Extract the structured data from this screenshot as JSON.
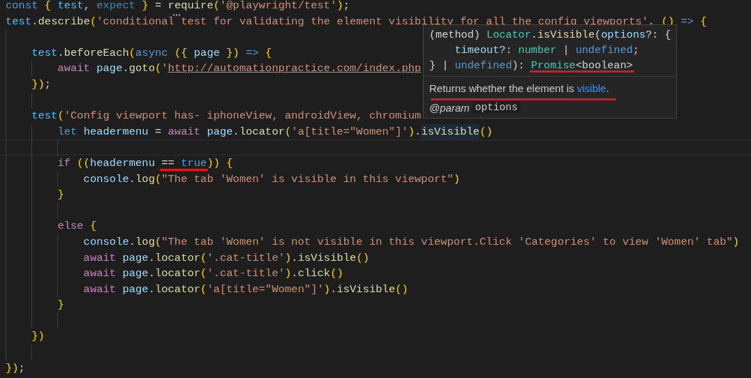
{
  "editor": {
    "lines": [
      {
        "kind": "code",
        "tokens": [
          {
            "kind": "kw",
            "text": "const"
          },
          {
            "kind": "br",
            "text": " {"
          },
          {
            "kind": "const",
            "text": " test"
          },
          {
            "kind": "pl",
            "text": ", "
          },
          {
            "kind": "unused",
            "text": "expect"
          },
          {
            "kind": "br",
            "text": " }"
          },
          {
            "kind": "pl",
            "text": " = "
          },
          {
            "kind": "fn",
            "text": "require",
            "hint": true
          },
          {
            "kind": "br",
            "text": "("
          },
          {
            "kind": "str",
            "text": "'@playwright/test'"
          },
          {
            "kind": "br",
            "text": ")"
          },
          {
            "kind": "pl",
            "text": ";"
          }
        ]
      },
      {
        "kind": "code",
        "tokens": [
          {
            "kind": "const",
            "text": "test"
          },
          {
            "kind": "pl",
            "text": "."
          },
          {
            "kind": "fn",
            "text": "describe"
          },
          {
            "kind": "br",
            "text": "("
          },
          {
            "kind": "str",
            "text": "'conditional test for validating the element visibility for all the config viewports'"
          },
          {
            "kind": "pl",
            "text": ", "
          },
          {
            "kind": "br",
            "text": "()"
          },
          {
            "kind": "kw",
            "text": " =>"
          },
          {
            "kind": "br",
            "text": " {"
          }
        ]
      },
      {
        "kind": "blank"
      },
      {
        "kind": "code",
        "tokens": [
          {
            "kind": "const",
            "text": "    test"
          },
          {
            "kind": "pl",
            "text": "."
          },
          {
            "kind": "fn",
            "text": "beforeEach"
          },
          {
            "kind": "br",
            "text": "("
          },
          {
            "kind": "kw",
            "text": "async"
          },
          {
            "kind": "br",
            "text": " ({"
          },
          {
            "kind": "var",
            "text": " page"
          },
          {
            "kind": "br",
            "text": " })"
          },
          {
            "kind": "kw",
            "text": " =>"
          },
          {
            "kind": "br",
            "text": " {"
          }
        ]
      },
      {
        "kind": "code",
        "tokens": [
          {
            "kind": "ctl",
            "text": "        await"
          },
          {
            "kind": "var",
            "text": " page"
          },
          {
            "kind": "pl",
            "text": "."
          },
          {
            "kind": "fn",
            "text": "goto"
          },
          {
            "kind": "br",
            "text": "("
          },
          {
            "kind": "str",
            "text": "'"
          },
          {
            "kind": "url",
            "text": "http://automationpractice.com/index.php"
          }
        ]
      },
      {
        "kind": "code",
        "tokens": [
          {
            "kind": "br",
            "text": "    })"
          },
          {
            "kind": "pl",
            "text": ";"
          }
        ]
      },
      {
        "kind": "blank"
      },
      {
        "kind": "code",
        "tokens": [
          {
            "kind": "const",
            "text": "    test"
          },
          {
            "kind": "br",
            "text": "("
          },
          {
            "kind": "str",
            "text": "'Config viewport has- iphoneView, androidView, chromium"
          }
        ]
      },
      {
        "kind": "code",
        "tokens": [
          {
            "kind": "kw",
            "text": "        let"
          },
          {
            "kind": "var",
            "text": " headermenu"
          },
          {
            "kind": "pl",
            "text": " = "
          },
          {
            "kind": "ctl",
            "text": "await"
          },
          {
            "kind": "var",
            "text": " page"
          },
          {
            "kind": "pl",
            "text": "."
          },
          {
            "kind": "fn",
            "text": "locator"
          },
          {
            "kind": "br",
            "text": "("
          },
          {
            "kind": "str",
            "text": "'a[title=\"Women\"]'"
          },
          {
            "kind": "br",
            "text": ")"
          },
          {
            "kind": "pl",
            "text": "."
          },
          {
            "kind": "fn",
            "text": "isVisible",
            "highlighted": true
          },
          {
            "kind": "br",
            "text": "()"
          }
        ]
      },
      {
        "kind": "blank",
        "current": true
      },
      {
        "kind": "code",
        "tokens": [
          {
            "kind": "ctl",
            "text": "        if"
          },
          {
            "kind": "br",
            "text": " (("
          },
          {
            "kind": "var",
            "text": "headermenu "
          },
          {
            "kind": "pl",
            "text": "== ",
            "marked": true
          },
          {
            "kind": "kw",
            "text": "true",
            "marked": true
          },
          {
            "kind": "br",
            "text": "))"
          },
          {
            "kind": "br",
            "text": " {"
          }
        ]
      },
      {
        "kind": "code",
        "tokens": [
          {
            "kind": "var",
            "text": "            console"
          },
          {
            "kind": "pl",
            "text": "."
          },
          {
            "kind": "fn",
            "text": "log"
          },
          {
            "kind": "br",
            "text": "("
          },
          {
            "kind": "str",
            "text": "\"The tab 'Women' is visible in this viewport\""
          },
          {
            "kind": "br",
            "text": ")"
          }
        ]
      },
      {
        "kind": "code",
        "tokens": [
          {
            "kind": "br",
            "text": "        }"
          }
        ]
      },
      {
        "kind": "blank"
      },
      {
        "kind": "code",
        "tokens": [
          {
            "kind": "ctl",
            "text": "        else"
          },
          {
            "kind": "br",
            "text": " {"
          }
        ]
      },
      {
        "kind": "code",
        "tokens": [
          {
            "kind": "var",
            "text": "            console"
          },
          {
            "kind": "pl",
            "text": "."
          },
          {
            "kind": "fn",
            "text": "log"
          },
          {
            "kind": "br",
            "text": "("
          },
          {
            "kind": "str",
            "text": "\"The tab 'Women' is not visible in this viewport.Click 'Categories' to view 'Women' tab\""
          },
          {
            "kind": "br",
            "text": ")"
          }
        ]
      },
      {
        "kind": "code",
        "tokens": [
          {
            "kind": "ctl",
            "text": "            await"
          },
          {
            "kind": "var",
            "text": " page"
          },
          {
            "kind": "pl",
            "text": "."
          },
          {
            "kind": "fn",
            "text": "locator"
          },
          {
            "kind": "br",
            "text": "("
          },
          {
            "kind": "str",
            "text": "'.cat-title'"
          },
          {
            "kind": "br",
            "text": ")"
          },
          {
            "kind": "pl",
            "text": "."
          },
          {
            "kind": "fn",
            "text": "isVisible"
          },
          {
            "kind": "br",
            "text": "()"
          }
        ]
      },
      {
        "kind": "code",
        "tokens": [
          {
            "kind": "ctl",
            "text": "            await"
          },
          {
            "kind": "var",
            "text": " page"
          },
          {
            "kind": "pl",
            "text": "."
          },
          {
            "kind": "fn",
            "text": "locator"
          },
          {
            "kind": "br",
            "text": "("
          },
          {
            "kind": "str",
            "text": "'.cat-title'"
          },
          {
            "kind": "br",
            "text": ")"
          },
          {
            "kind": "pl",
            "text": "."
          },
          {
            "kind": "fn",
            "text": "click"
          },
          {
            "kind": "br",
            "text": "()"
          }
        ]
      },
      {
        "kind": "code",
        "tokens": [
          {
            "kind": "ctl",
            "text": "            await"
          },
          {
            "kind": "var",
            "text": " page"
          },
          {
            "kind": "pl",
            "text": "."
          },
          {
            "kind": "fn",
            "text": "locator"
          },
          {
            "kind": "br",
            "text": "("
          },
          {
            "kind": "str",
            "text": "'a[title=\"Women\"]'"
          },
          {
            "kind": "br",
            "text": ")"
          },
          {
            "kind": "pl",
            "text": "."
          },
          {
            "kind": "fn",
            "text": "isVisible"
          },
          {
            "kind": "br",
            "text": "()"
          }
        ]
      },
      {
        "kind": "code",
        "tokens": [
          {
            "kind": "br",
            "text": "        }"
          }
        ]
      },
      {
        "kind": "blank"
      },
      {
        "kind": "code",
        "tokens": [
          {
            "kind": "br",
            "text": "    })"
          }
        ]
      },
      {
        "kind": "blank"
      },
      {
        "kind": "code",
        "tokens": [
          {
            "kind": "br",
            "text": "})"
          },
          {
            "kind": "pl",
            "text": ";"
          }
        ]
      }
    ]
  },
  "tooltip": {
    "signature": [
      {
        "tokens": [
          {
            "kind": "pl",
            "text": "(method) "
          },
          {
            "kind": "type",
            "text": "Locator"
          },
          {
            "kind": "pl",
            "text": "."
          },
          {
            "kind": "fn",
            "text": "isVisible"
          },
          {
            "kind": "pl",
            "text": "("
          },
          {
            "kind": "var",
            "text": "options"
          },
          {
            "kind": "pl",
            "text": "?: {"
          }
        ]
      },
      {
        "tokens": [
          {
            "kind": "var",
            "text": "    timeout"
          },
          {
            "kind": "pl",
            "text": "?: "
          },
          {
            "kind": "type",
            "text": "number"
          },
          {
            "kind": "pl",
            "text": " | "
          },
          {
            "kind": "kw",
            "text": "undefined"
          },
          {
            "kind": "pl",
            "text": ";"
          }
        ]
      },
      {
        "tokens": [
          {
            "kind": "pl",
            "text": "} | "
          },
          {
            "kind": "kw",
            "text": "undefined"
          },
          {
            "kind": "pl",
            "text": "): "
          },
          {
            "kind": "type",
            "text": "Promise",
            "marked": true
          },
          {
            "kind": "pl",
            "text": "<boolean>",
            "marked": true
          }
        ]
      }
    ],
    "description": {
      "text": "Returns whether the element is ",
      "link": "visible",
      "after": ".",
      "marked": true
    },
    "param": {
      "tag": "@param",
      "name": "options"
    }
  }
}
